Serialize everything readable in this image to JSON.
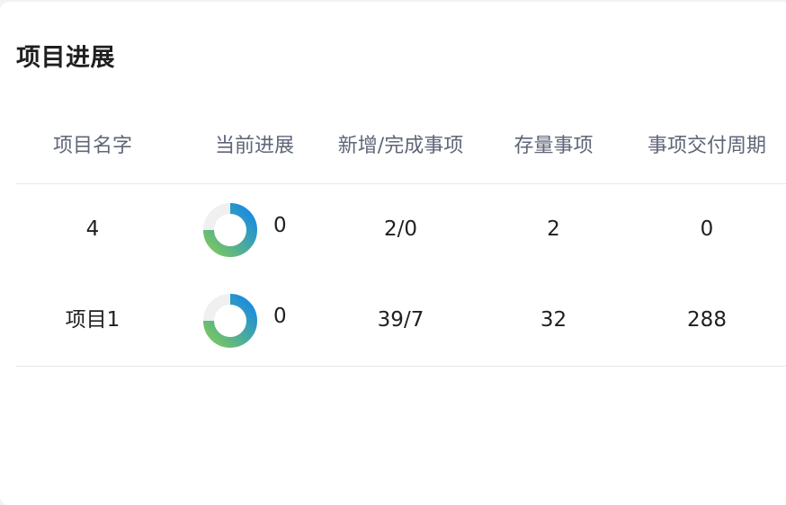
{
  "card": {
    "title": "项目进展"
  },
  "table": {
    "headers": [
      "项目名字",
      "当前进展",
      "新增/完成事项",
      "存量事项",
      "事项交付周期"
    ],
    "rows": [
      {
        "name": "4",
        "progress": "0",
        "added_completed": "2/0",
        "stock": "2",
        "delivery_cycle": "0"
      },
      {
        "name": "项目1",
        "progress": "0",
        "added_completed": "39/7",
        "stock": "32",
        "delivery_cycle": "288"
      }
    ]
  },
  "colors": {
    "ring_track": "#f0f0f0",
    "ring_gradient_start": "#7cc95b",
    "ring_gradient_end": "#1488e8",
    "header_text": "#5f6678",
    "body_text": "#1f1f1f"
  },
  "icons": [
    "progress-donut-icon"
  ]
}
